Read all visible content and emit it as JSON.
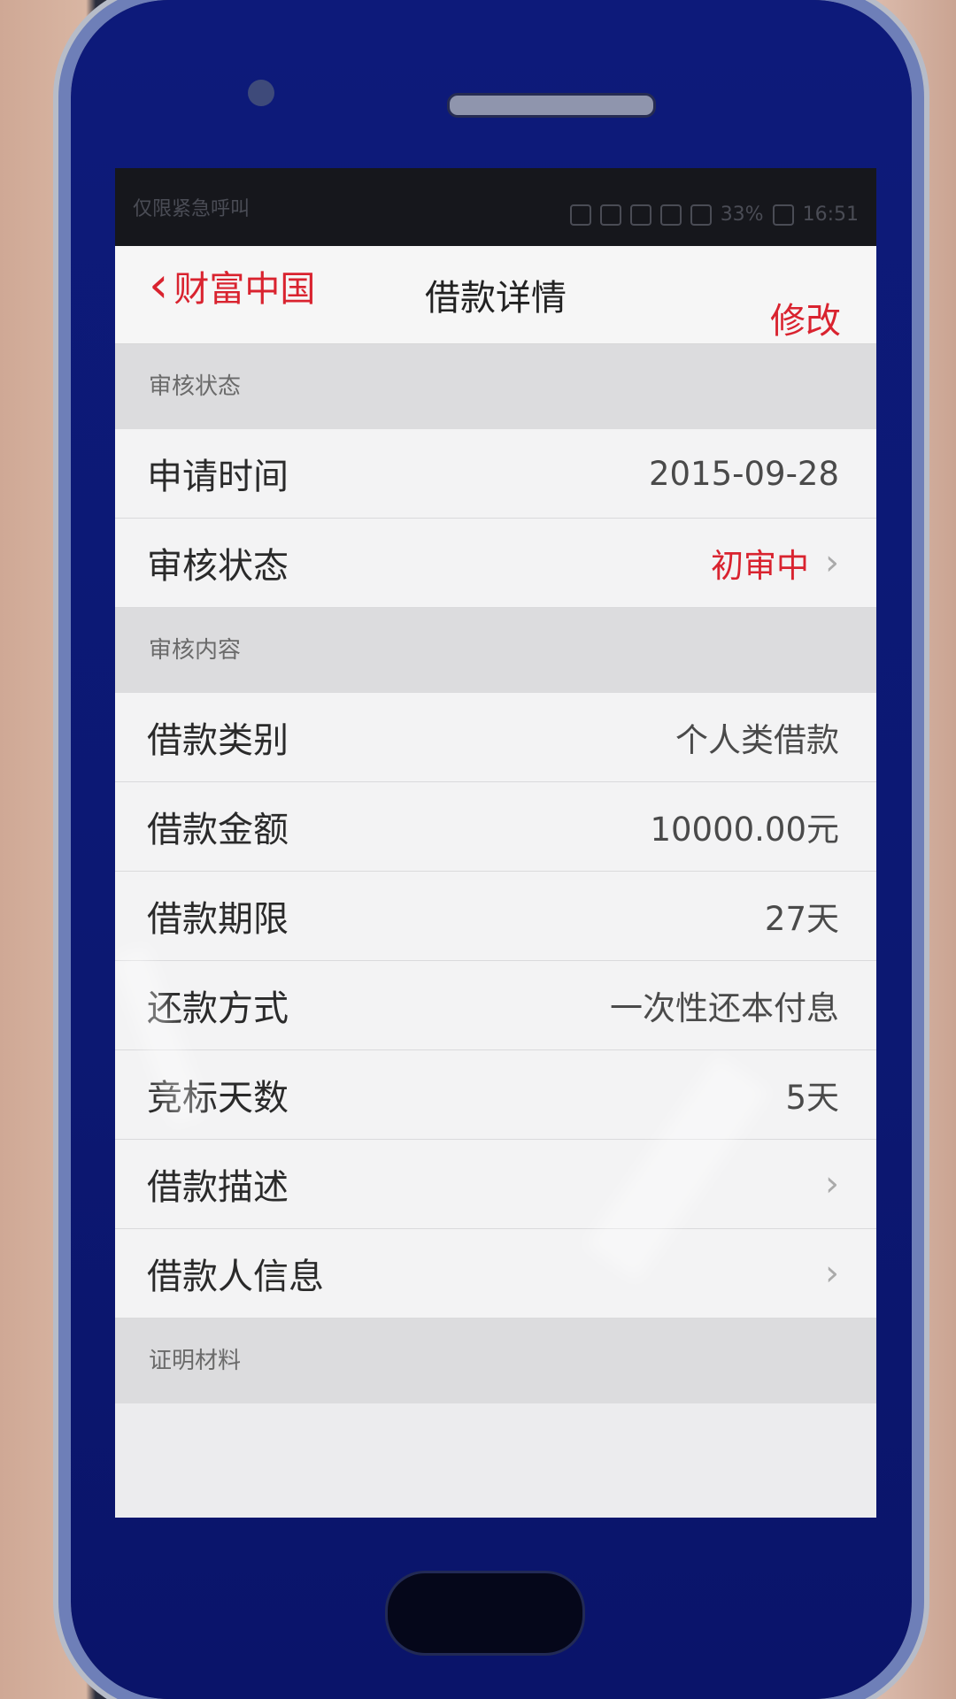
{
  "status_bar": {
    "carrier": "仅限紧急呼叫",
    "battery": "33%",
    "time": "16:51"
  },
  "nav": {
    "back_label": "财富中国",
    "title": "借款详情",
    "edit_label": "修改"
  },
  "sections": {
    "review_status": {
      "header": "审核状态",
      "rows": [
        {
          "label": "申请时间",
          "value": "2015-09-28"
        },
        {
          "label": "审核状态",
          "value": "初审中"
        }
      ]
    },
    "review_content": {
      "header": "审核内容",
      "rows": [
        {
          "label": "借款类别",
          "value": "个人类借款"
        },
        {
          "label": "借款金额",
          "value": "10000.00元"
        },
        {
          "label": "借款期限",
          "value": "27天"
        },
        {
          "label": "还款方式",
          "value": "一次性还本付息"
        },
        {
          "label": "竞标天数",
          "value": "5天"
        },
        {
          "label": "借款描述",
          "value": ""
        },
        {
          "label": "借款人信息",
          "value": ""
        }
      ]
    },
    "proof": {
      "header": "证明材料"
    }
  },
  "colors": {
    "accent_red": "#d9232f",
    "phone_blue": "#0d1a7a"
  }
}
